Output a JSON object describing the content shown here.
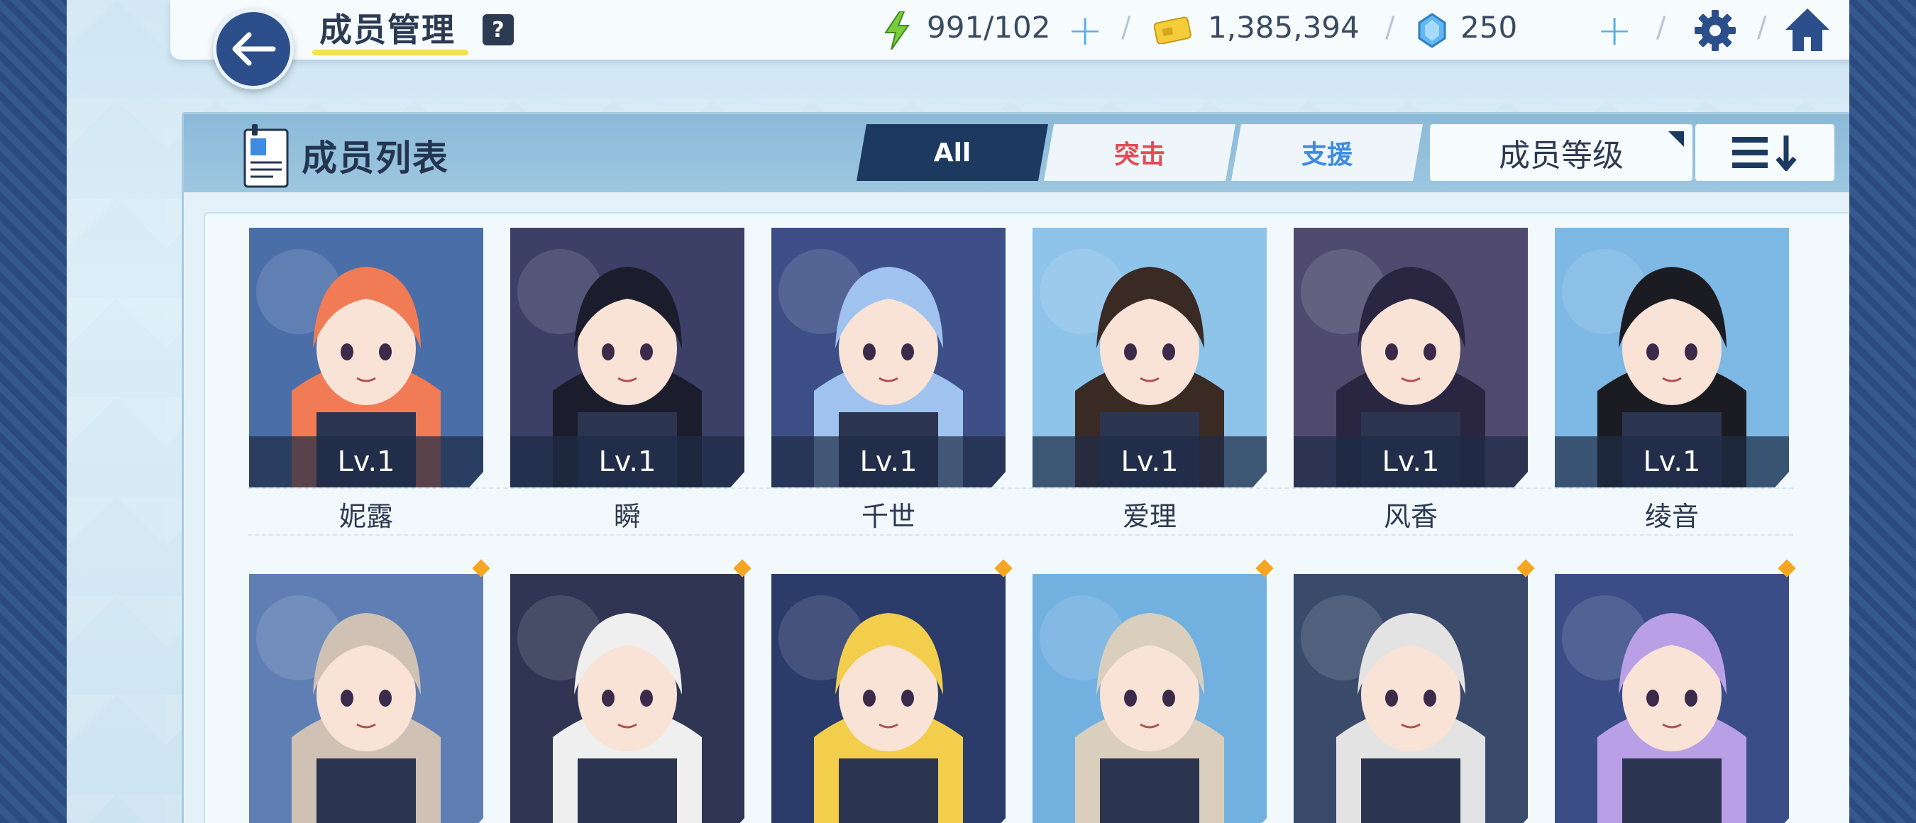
{
  "header": {
    "title": "成员管理",
    "help_label": "?",
    "energy": "991/102",
    "credits": "1,385,394",
    "gems": "250"
  },
  "panel": {
    "title": "成员列表",
    "tabs": [
      {
        "label": "All",
        "selected": true
      },
      {
        "label": "突击",
        "color": "#e34b55"
      },
      {
        "label": "支援",
        "color": "#3f8be2"
      }
    ],
    "sort_label": "成员等级"
  },
  "members_row1": [
    {
      "name": "妮露",
      "level": "Lv.1",
      "hair": "#f07b55",
      "bg": "#4a6ea8"
    },
    {
      "name": "瞬",
      "level": "Lv.1",
      "hair": "#1c1d2c",
      "bg": "#3c3f66"
    },
    {
      "name": "千世",
      "level": "Lv.1",
      "hair": "#9fc3ee",
      "bg": "#3d4f86"
    },
    {
      "name": "爱理",
      "level": "Lv.1",
      "hair": "#3a2a24",
      "bg": "#8ec3ea"
    },
    {
      "name": "风香",
      "level": "Lv.1",
      "hair": "#2a2540",
      "bg": "#4f4a6e"
    },
    {
      "name": "绫音",
      "level": "Lv.1",
      "hair": "#1b1b22",
      "bg": "#7eb8e4"
    }
  ],
  "members_row2": [
    {
      "hair": "#cfc2b4",
      "bg": "#5f7fb4"
    },
    {
      "hair": "#efefef",
      "bg": "#2f3552"
    },
    {
      "hair": "#f3cd4c",
      "bg": "#2b3b6a"
    },
    {
      "hair": "#d9cfbc",
      "bg": "#72b0e0"
    },
    {
      "hair": "#e3e3e3",
      "bg": "#3a4a6a"
    },
    {
      "hair": "#b9a0e6",
      "bg": "#3a4d86"
    }
  ],
  "colors": {
    "accent": "#1c3a60",
    "plus": "#55aee8",
    "gold": "#f5a623"
  }
}
